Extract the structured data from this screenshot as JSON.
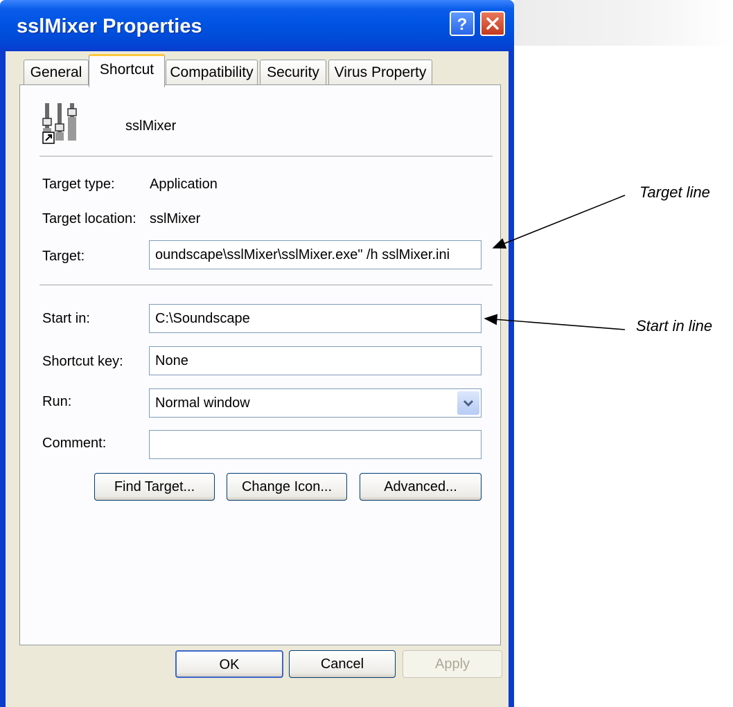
{
  "window": {
    "title": "sslMixer Properties"
  },
  "titlebar_buttons": {
    "help": "help-icon",
    "close": "close-icon"
  },
  "tabs": [
    {
      "label": "General",
      "active": false
    },
    {
      "label": "Shortcut",
      "active": true
    },
    {
      "label": "Compatibility",
      "active": false
    },
    {
      "label": "Security",
      "active": false
    },
    {
      "label": "Virus Property",
      "active": false
    }
  ],
  "shortcut": {
    "app_name": "sslMixer",
    "target_type_label": "Target type:",
    "target_type_value": "Application",
    "target_location_label": "Target location:",
    "target_location_value": "sslMixer",
    "target_label": "Target:",
    "target_value": "oundscape\\sslMixer\\sslMixer.exe\"  /h sslMixer.ini",
    "start_in_label": "Start in:",
    "start_in_value": "C:\\Soundscape",
    "shortcut_key_label": "Shortcut key:",
    "shortcut_key_value": "None",
    "run_label": "Run:",
    "run_value": "Normal window",
    "comment_label": "Comment:",
    "comment_value": "",
    "find_target": "Find Target...",
    "change_icon": "Change Icon...",
    "advanced": "Advanced..."
  },
  "dialog_buttons": {
    "ok": "OK",
    "cancel": "Cancel",
    "apply": "Apply"
  },
  "annotations": {
    "target_line": "Target line",
    "start_in_line": "Start in line"
  },
  "colors": {
    "titlebar": "#0054e3",
    "dialog_bg": "#ece9d8",
    "panel_bg": "#fcfcfe",
    "field_border": "#7f9db9",
    "tab_highlight": "#ffc83c"
  }
}
